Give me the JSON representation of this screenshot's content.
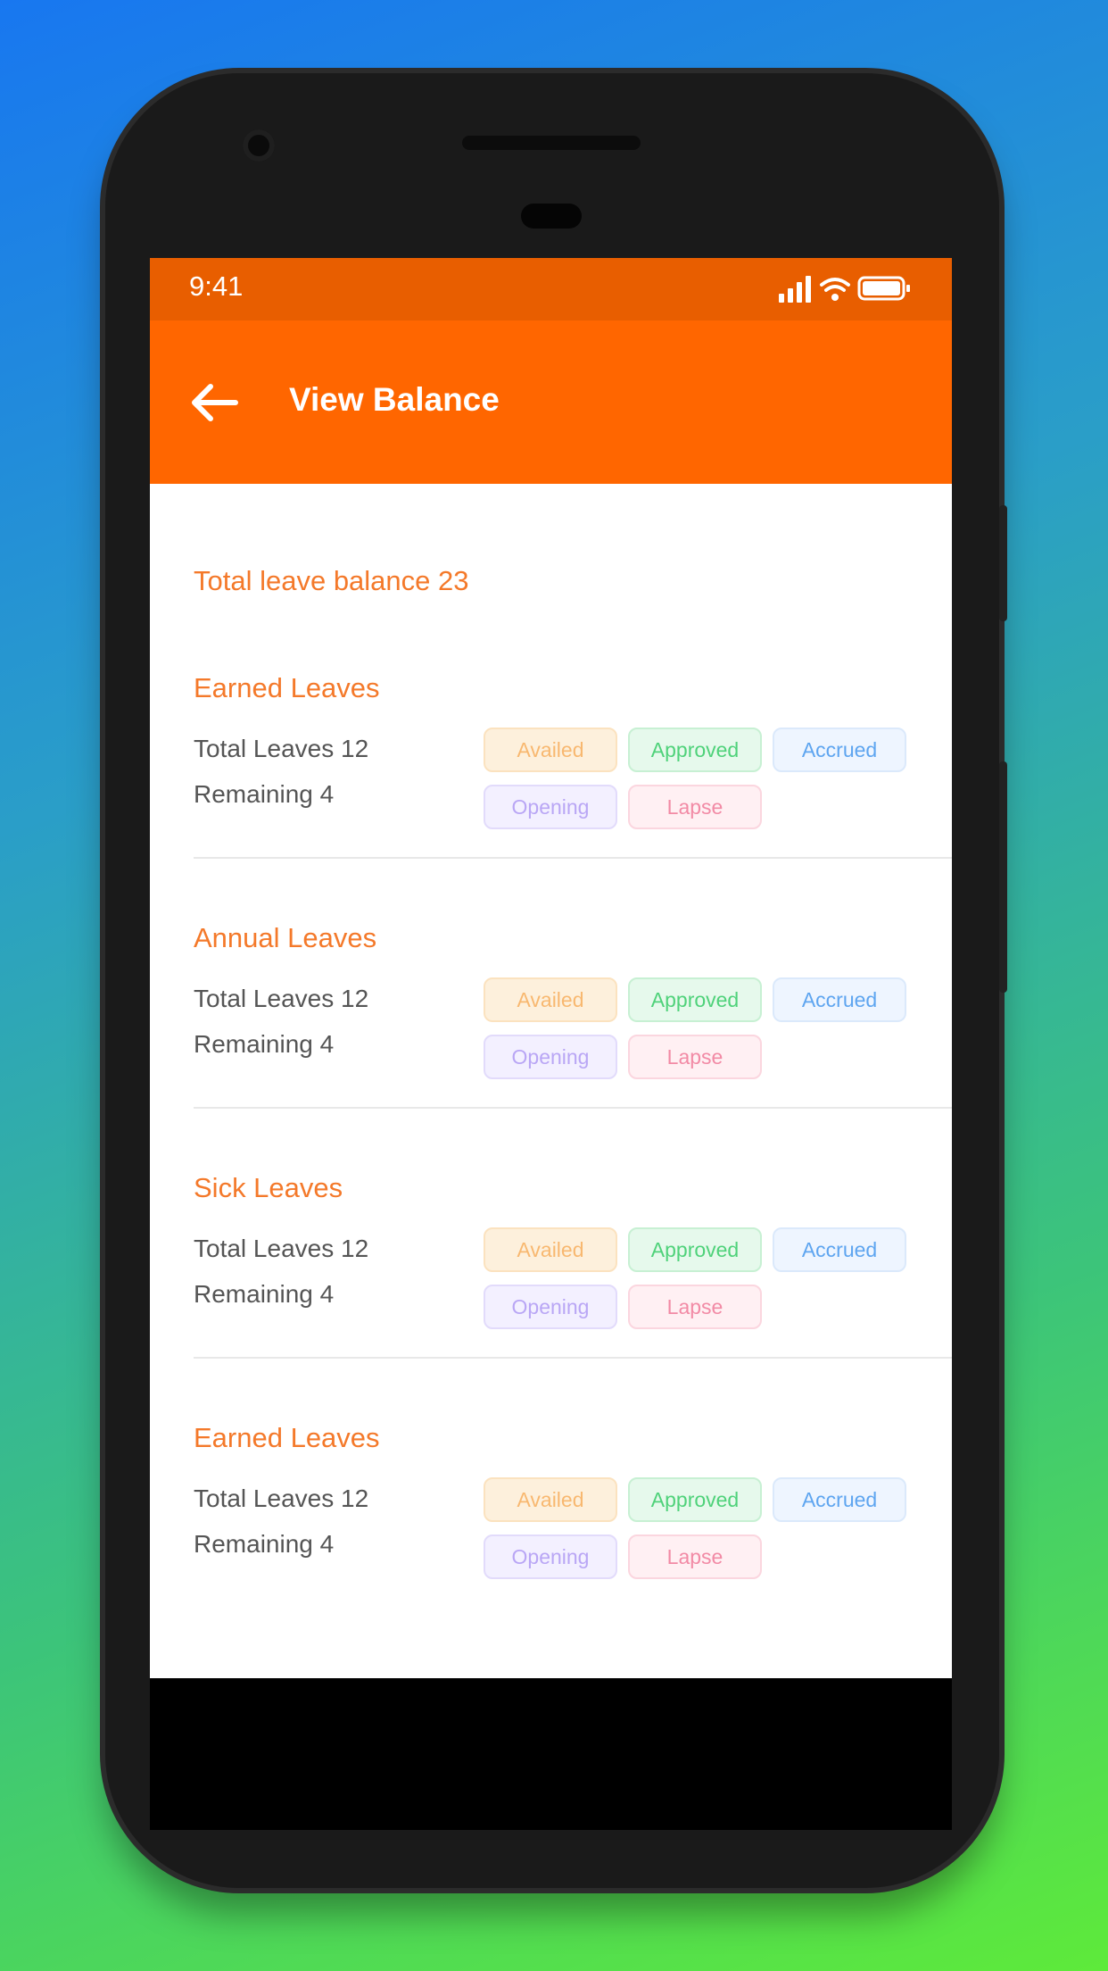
{
  "status_bar": {
    "time": "9:41"
  },
  "header": {
    "title": "View Balance"
  },
  "summary": {
    "total_text": "Total leave balance 23"
  },
  "chip_colors": {
    "Availed": [
      "#fdf0dc",
      "#f8b870",
      "#fbe2bf"
    ],
    "Approved": [
      "#e6f9ec",
      "#4fd27a",
      "#c7f0d3"
    ],
    "Accrued": [
      "#eef5ff",
      "#5ea5f0",
      "#dbe9fb"
    ],
    "Opening": [
      "#f3f0ff",
      "#b9a6f5",
      "#e2dbfb"
    ],
    "Lapse": [
      "#fff0f3",
      "#f28aa5",
      "#fbd6df"
    ]
  },
  "sections": [
    {
      "title": "Earned Leaves",
      "total": "Total Leaves 12",
      "remaining": "Remaining 4",
      "chips": [
        "Availed",
        "Approved",
        "Accrued",
        "Opening",
        "Lapse"
      ]
    },
    {
      "title": "Annual Leaves",
      "total": "Total Leaves 12",
      "remaining": "Remaining 4",
      "chips": [
        "Availed",
        "Approved",
        "Accrued",
        "Opening",
        "Lapse"
      ]
    },
    {
      "title": "Sick Leaves",
      "total": "Total Leaves 12",
      "remaining": "Remaining 4",
      "chips": [
        "Availed",
        "Approved",
        "Accrued",
        "Opening",
        "Lapse"
      ]
    },
    {
      "title": "Earned Leaves",
      "total": "Total Leaves 12",
      "remaining": "Remaining 4",
      "chips": [
        "Availed",
        "Approved",
        "Accrued",
        "Opening",
        "Lapse"
      ]
    }
  ]
}
